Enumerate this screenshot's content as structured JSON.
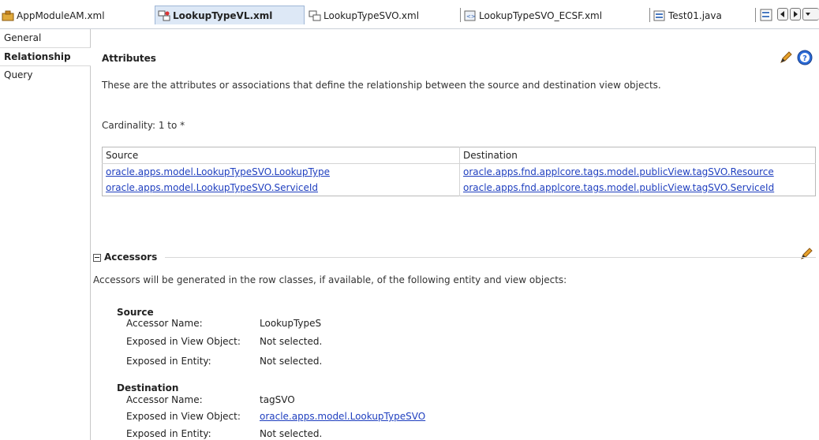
{
  "tabs": [
    {
      "label": "AppModuleAM.xml",
      "icon": "app-module-icon"
    },
    {
      "label": "LookupTypeVL.xml",
      "icon": "view-link-icon",
      "active": true
    },
    {
      "label": "LookupTypeSVO.xml",
      "icon": "view-object-icon"
    },
    {
      "label": "LookupTypeSVO_ECSF.xml",
      "icon": "xml-file-icon"
    },
    {
      "label": "Test01.java",
      "icon": "java-file-icon"
    }
  ],
  "nav": {
    "items": [
      "General",
      "Relationship",
      "Query"
    ],
    "selected": "Relationship"
  },
  "attributes": {
    "title": "Attributes",
    "description": "These are the attributes or associations that define the relationship between the source and destination view objects.",
    "cardinality": "Cardinality: 1 to *",
    "table": {
      "headers": [
        "Source",
        "Destination"
      ],
      "rows": [
        [
          "oracle.apps.model.LookupTypeSVO.LookupType",
          "oracle.apps.fnd.applcore.tags.model.publicView.tagSVO.Resource"
        ],
        [
          "oracle.apps.model.LookupTypeSVO.ServiceId",
          "oracle.apps.fnd.applcore.tags.model.publicView.tagSVO.ServiceId"
        ]
      ]
    }
  },
  "accessors": {
    "title": "Accessors",
    "description": "Accessors will be generated in the row classes, if available, of the following entity and view objects:",
    "source": {
      "title": "Source",
      "accessor_name_label": "Accessor Name:",
      "accessor_name": "LookupTypeS",
      "exposed_vo_label": "Exposed in View Object:",
      "exposed_vo": "Not selected.",
      "exposed_entity_label": "Exposed in Entity:",
      "exposed_entity": "Not selected."
    },
    "destination": {
      "title": "Destination",
      "accessor_name_label": "Accessor Name:",
      "accessor_name": "tagSVO",
      "exposed_vo_label": "Exposed in View Object:",
      "exposed_vo": "oracle.apps.model.LookupTypeSVO",
      "exposed_entity_label": "Exposed in Entity:",
      "exposed_entity": "Not selected."
    }
  },
  "colors": {
    "accent": "#1f3fbf",
    "help": "#2a6ad6",
    "edit": "#d98a1c"
  }
}
